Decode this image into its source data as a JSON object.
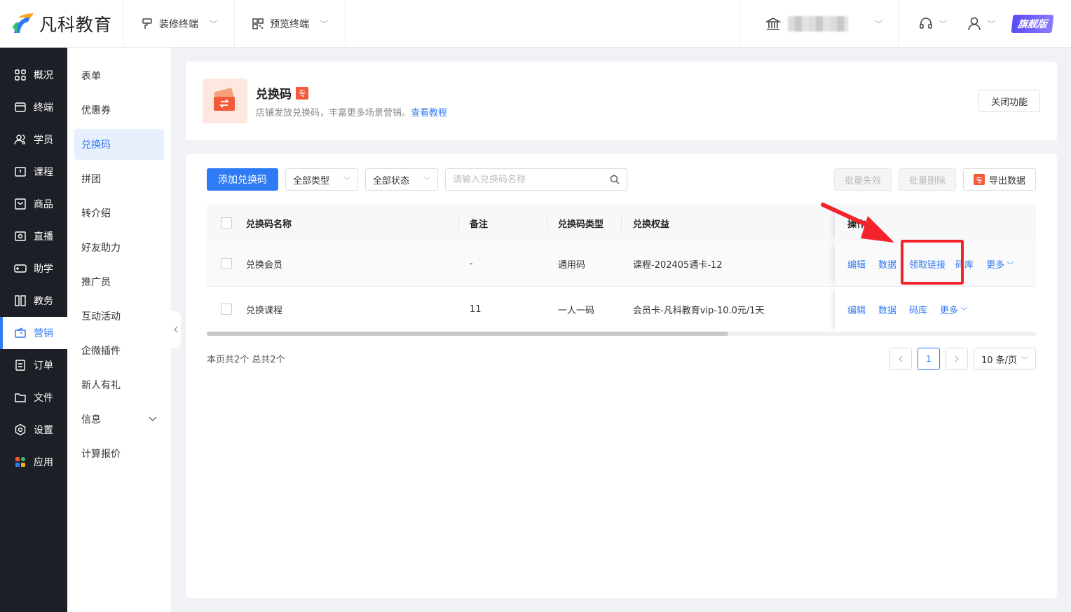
{
  "brand": {
    "name": "凡科教育"
  },
  "topbar": {
    "menus": [
      {
        "label": "装修终端",
        "icon": "brush-icon"
      },
      {
        "label": "预览终端",
        "icon": "qrcode-icon"
      }
    ],
    "vip_label": "旗舰版"
  },
  "sidebar": {
    "items": [
      {
        "label": "概况",
        "icon": "grid-icon"
      },
      {
        "label": "终端",
        "icon": "store-icon"
      },
      {
        "label": "学员",
        "icon": "users-icon"
      },
      {
        "label": "课程",
        "icon": "course-icon"
      },
      {
        "label": "商品",
        "icon": "goods-icon"
      },
      {
        "label": "直播",
        "icon": "live-icon"
      },
      {
        "label": "助学",
        "icon": "gamepad-icon"
      },
      {
        "label": "教务",
        "icon": "book-icon"
      },
      {
        "label": "营销",
        "icon": "marketing-icon",
        "active": true
      },
      {
        "label": "订单",
        "icon": "order-icon"
      },
      {
        "label": "文件",
        "icon": "folder-icon"
      },
      {
        "label": "设置",
        "icon": "settings-icon"
      },
      {
        "label": "应用",
        "icon": "apps-icon"
      }
    ]
  },
  "submenu": {
    "items": [
      {
        "label": "表单"
      },
      {
        "label": "优惠券"
      },
      {
        "label": "兑换码",
        "active": true
      },
      {
        "label": "拼团"
      },
      {
        "label": "转介绍"
      },
      {
        "label": "好友助力"
      },
      {
        "label": "推广员"
      },
      {
        "label": "互动活动"
      },
      {
        "label": "企微插件"
      },
      {
        "label": "新人有礼"
      },
      {
        "label": "信息",
        "has_children": true
      },
      {
        "label": "计算报价"
      }
    ]
  },
  "header": {
    "title": "兑换码",
    "pro_tag": "专",
    "desc": "店铺发放兑换码，丰富更多场景营销。",
    "tutorial_link": "查看教程",
    "close_button": "关闭功能"
  },
  "toolbar": {
    "add_button": "添加兑换码",
    "type_filter": "全部类型",
    "status_filter": "全部状态",
    "search_placeholder": "请输入兑换码名称",
    "batch_disable": "批量失效",
    "batch_delete": "批量删除",
    "export_tag": "专",
    "export": "导出数据"
  },
  "table": {
    "columns": {
      "name": "兑换码名称",
      "remark": "备注",
      "type": "兑换码类型",
      "benefit": "兑换权益",
      "ops": "操作"
    },
    "rows": [
      {
        "name": "兑换会员",
        "remark": "-",
        "type": "通用码",
        "benefit": "课程-202405通卡-12",
        "ops": [
          "编辑",
          "数据",
          "领取链接",
          "码库",
          "更多"
        ]
      },
      {
        "name": "兑换课程",
        "remark": "11",
        "type": "一人一码",
        "benefit": "会员卡-凡科教育vip-10.0元/1天",
        "ops": [
          "编辑",
          "数据",
          "码库",
          "更多"
        ]
      }
    ]
  },
  "pagination": {
    "summary": "本页共2个 总共2个",
    "current_page": "1",
    "page_size": "10 条/页"
  },
  "colors": {
    "primary": "#2f7bf5",
    "annotation": "#f4232b",
    "sidebar_bg": "#1d1f26"
  }
}
